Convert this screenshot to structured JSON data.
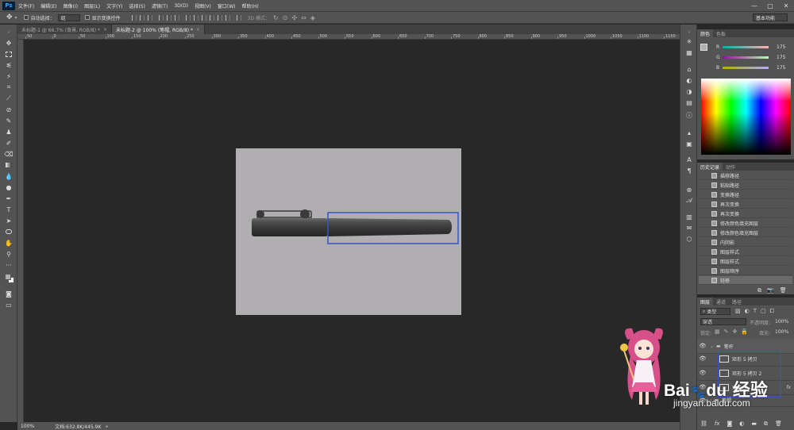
{
  "menubar": {
    "logo": "Ps",
    "items": [
      "文件(F)",
      "编辑(E)",
      "图像(I)",
      "图层(L)",
      "文字(Y)",
      "选择(S)",
      "滤镜(T)",
      "3D(D)",
      "视图(V)",
      "窗口(W)",
      "帮助(H)"
    ],
    "window_controls": [
      "—",
      "□",
      "✕"
    ]
  },
  "optionsbar": {
    "auto_select_label": "自动选择：",
    "auto_select_value": "组",
    "show_transform_label": "显示变换控件",
    "mode_3d_label": "3D 模式：",
    "workspace": "基本功能"
  },
  "tabs": [
    {
      "label": "未标题-1 @ 66.7% (背景, RGB/8) *",
      "close": "×"
    },
    {
      "label": "未标题-2 @ 100% (笔帽, RGB/8) *",
      "close": "×"
    }
  ],
  "ruler": {
    "labels": [
      "50",
      "0",
      "50",
      "100",
      "150",
      "200",
      "250",
      "300",
      "350",
      "400",
      "450",
      "500",
      "550",
      "600",
      "650",
      "700",
      "750",
      "800",
      "850",
      "900",
      "950",
      "1000",
      "1050",
      "1100",
      "1150"
    ]
  },
  "status": {
    "zoom": "100%",
    "doc": "文档:632.8K/445.9K"
  },
  "color_panel": {
    "tabs": [
      "颜色",
      "色板"
    ],
    "channels": [
      {
        "label": "R",
        "value": "175"
      },
      {
        "label": "G",
        "value": "175"
      },
      {
        "label": "B",
        "value": "175"
      }
    ]
  },
  "history_panel": {
    "tabs": [
      "历史记录",
      "动作"
    ],
    "items": [
      "描移路径",
      "粘贴路径",
      "变换路径",
      "再次变换",
      "再次变换",
      "修改颜色填充图层",
      "修改颜色填充图层",
      "内阴影",
      "图层样式",
      "图层样式",
      "图层顺序",
      "轻移"
    ]
  },
  "layers_panel": {
    "tabs": [
      "图层",
      "通道",
      "路径"
    ],
    "filter_kind": "类型",
    "blend_mode": "穿透",
    "opacity_label": "不透明度:",
    "opacity": "100%",
    "lock_label": "锁定:",
    "fill_label": "填充:",
    "fill": "100%",
    "group_name": "笔杆",
    "layers": [
      "矩形 5 拷贝",
      "矩形 5 拷贝 2",
      "矩形 5"
    ],
    "bottom_layer": "笔帽"
  },
  "watermark": {
    "brand_a": "Bai",
    "brand_b": "du",
    "product": "经验",
    "url": "jingyan.baidu.com"
  },
  "colors": {
    "selection": "#3355cc",
    "canvas": "#b0aeb0",
    "pen": "#3c3c3c"
  }
}
